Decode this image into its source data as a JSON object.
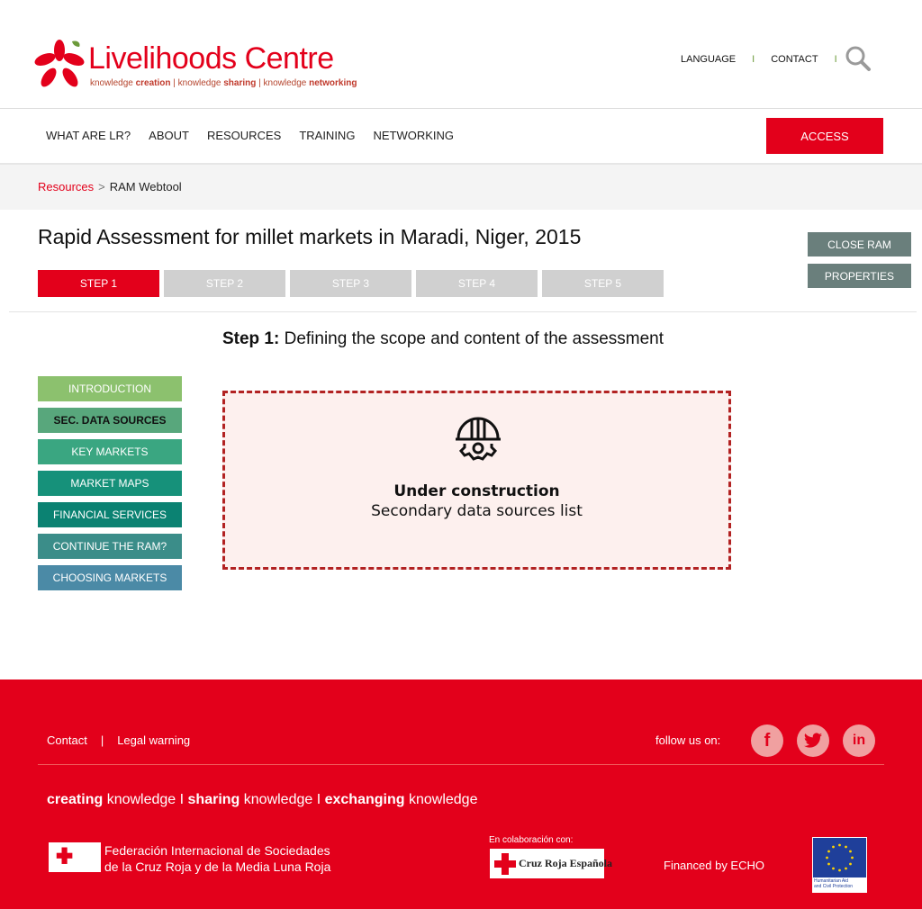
{
  "header": {
    "logo_title_bold": "Live",
    "logo_title_light": "lihoods Centre",
    "logo_tag_1": "knowledge ",
    "logo_tag_1b": "creation",
    "logo_tag_2": " | knowledge ",
    "logo_tag_2b": "sharing",
    "logo_tag_3": " | knowledge ",
    "logo_tag_3b": "networking",
    "top_links": [
      "LANGUAGE",
      "CONTACT"
    ],
    "separator": "I"
  },
  "mainnav": {
    "items": [
      "WHAT ARE LR?",
      "ABOUT",
      "RESOURCES",
      "TRAINING",
      "NETWORKING"
    ],
    "access_label": "ACCESS"
  },
  "breadcrumb": {
    "link": "Resources",
    "gt": ">",
    "current": "RAM Webtool"
  },
  "page": {
    "title": "Rapid Assessment for millet markets in Maradi, Niger, 2015",
    "close_label": "CLOSE RAM",
    "properties_label": "PROPERTIES",
    "steps": [
      "STEP 1",
      "STEP 2",
      "STEP 3",
      "STEP 4",
      "STEP 5"
    ],
    "active_step": 1,
    "heading_bold": "Step 1:",
    "heading_text": " Defining the scope and content of the assessment"
  },
  "menu": {
    "items": [
      {
        "label": "INTRODUCTION",
        "color": "#8cc16e"
      },
      {
        "label": "SEC. DATA SOURCES",
        "color": "#58a77c"
      },
      {
        "label": "KEY MARKETS",
        "color": "#3aa681"
      },
      {
        "label": "MARKET MAPS",
        "color": "#16917a"
      },
      {
        "label": "FINANCIAL SERVICES",
        "color": "#0b8272"
      },
      {
        "label": "CONTINUE THE RAM?",
        "color": "#3b8d89"
      },
      {
        "label": "CHOOSING MARKETS",
        "color": "#4b8aa6"
      }
    ],
    "active_index": 1
  },
  "construction": {
    "title": "Under construction",
    "subtitle": "Secondary data sources list"
  },
  "footer": {
    "links": [
      "Contact",
      "Legal warning"
    ],
    "link_sep": "|",
    "follow": "follow us on:",
    "social": [
      "f",
      "t",
      "in"
    ],
    "tag": [
      {
        "b": "creating",
        "t": " knowledge I "
      },
      {
        "b": "sharing",
        "t": " knowledge I "
      },
      {
        "b": "exchanging",
        "t": " knowledge"
      }
    ],
    "ifrc_line1": "Federación Internacional de Sociedades",
    "ifrc_line2": "de la Cruz Roja y de la Media Luna Roja",
    "colab": "En colaboración con:",
    "cre": "Cruz Roja Española",
    "financed": "Financed by ECHO",
    "eu_text_1": "Humanitarian Aid",
    "eu_text_2": "and Civil Protection"
  },
  "colors": {
    "brand_red": "#e3001b",
    "side_button": "#6a7f7c",
    "step_inactive": "#d0d0d0"
  }
}
